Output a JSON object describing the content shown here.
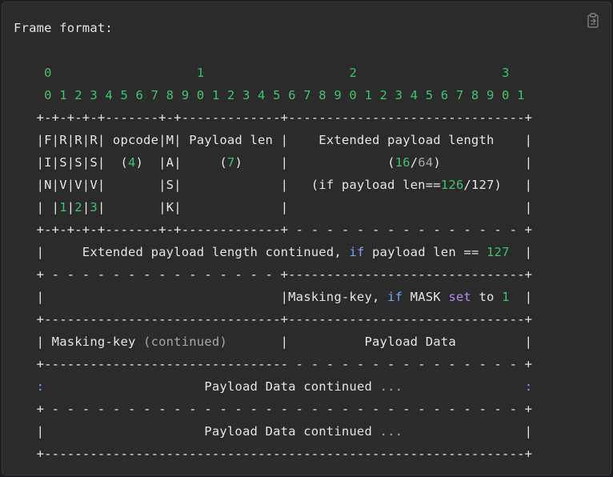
{
  "header": {
    "title": "Frame format:",
    "copy_icon": "clipboard-copy-icon"
  },
  "diagram": {
    "lines": [
      [
        {
          "t": "    "
        },
        {
          "t": "0",
          "c": "num"
        },
        {
          "t": "                   "
        },
        {
          "t": "1",
          "c": "num"
        },
        {
          "t": "                   "
        },
        {
          "t": "2",
          "c": "num"
        },
        {
          "t": "                   "
        },
        {
          "t": "3",
          "c": "num"
        }
      ],
      [
        {
          "t": "    "
        },
        {
          "t": "0 1 2 3 4 5 6 7 8 9 0 1 2 3 4 5 6 7 8 9 0 1 2 3 4 5 6 7 8 9 0 1",
          "c": "num"
        }
      ],
      [
        {
          "t": "   +-+-+-+-+-------+-+-------------+-------------------------------+"
        }
      ],
      [
        {
          "t": "   |F|R|R|R| opcode|M| Payload len |    Extended payload length    |"
        }
      ],
      [
        {
          "t": "   |I|S|S|S|  ("
        },
        {
          "t": "4",
          "c": "num"
        },
        {
          "t": ")  |A|     ("
        },
        {
          "t": "7",
          "c": "num"
        },
        {
          "t": ")     |             ("
        },
        {
          "t": "16",
          "c": "num"
        },
        {
          "t": "/"
        },
        {
          "t": "64",
          "c": "dim"
        },
        {
          "t": ")           |"
        }
      ],
      [
        {
          "t": "   |N|V|V|V|       |S|             |   (if payload len=="
        },
        {
          "t": "126",
          "c": "num"
        },
        {
          "t": "/127)   |"
        }
      ],
      [
        {
          "t": "   | |"
        },
        {
          "t": "1",
          "c": "num"
        },
        {
          "t": "|"
        },
        {
          "t": "2",
          "c": "num"
        },
        {
          "t": "|"
        },
        {
          "t": "3",
          "c": "num"
        },
        {
          "t": "|       |K|             |                               |"
        }
      ],
      [
        {
          "t": "   +-+-+-+-+-------+-+-------------+ - - - - - - - - - - - - - - - +"
        }
      ],
      [
        {
          "t": "   |     Extended payload length continued, "
        },
        {
          "t": "if",
          "c": "kw"
        },
        {
          "t": " payload len == "
        },
        {
          "t": "127",
          "c": "num"
        },
        {
          "t": "  |"
        }
      ],
      [
        {
          "t": "   + - - - - - - - - - - - - - - - +-------------------------------+"
        }
      ],
      [
        {
          "t": "   |                               |Masking-key, "
        },
        {
          "t": "if",
          "c": "kw"
        },
        {
          "t": " MASK "
        },
        {
          "t": "set",
          "c": "kw2"
        },
        {
          "t": " to "
        },
        {
          "t": "1",
          "c": "num"
        },
        {
          "t": "  |"
        }
      ],
      [
        {
          "t": "   +-------------------------------+-------------------------------+"
        }
      ],
      [
        {
          "t": "   | Masking-key "
        },
        {
          "t": "(continued)",
          "c": "dim"
        },
        {
          "t": "       |          Payload Data         |"
        }
      ],
      [
        {
          "t": "   +-------------------------------- - - - - - - - - - - - - - - - +"
        }
      ],
      [
        {
          "t": "   "
        },
        {
          "t": ":",
          "c": "kw"
        },
        {
          "t": "                     Payload Data continued "
        },
        {
          "t": "...",
          "c": "dim"
        },
        {
          "t": "                "
        },
        {
          "t": ":",
          "c": "kw"
        }
      ],
      [
        {
          "t": "   + - - - - - - - - - - - - - - - - - - - - - - - - - - - - - - - +"
        }
      ],
      [
        {
          "t": "   |                     Payload Data continued "
        },
        {
          "t": "...",
          "c": "dim"
        },
        {
          "t": "                |"
        }
      ],
      [
        {
          "t": "   +---------------------------------------------------------------+"
        }
      ]
    ],
    "colors": {
      "number": "#3fc26e",
      "keyword": "#7aa2f7",
      "keyword_alt": "#b08cf0",
      "dim": "#a7a7a7",
      "text": "#e4e4e4",
      "background": "#2b2b2b"
    }
  }
}
